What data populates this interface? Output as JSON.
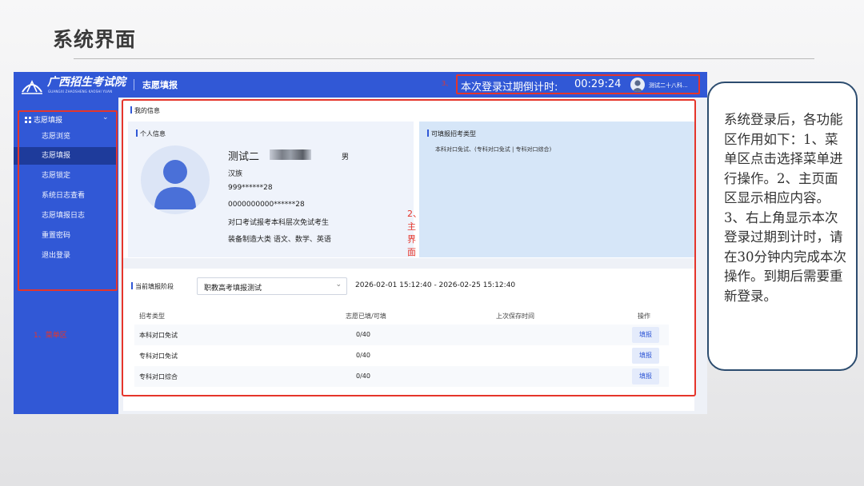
{
  "slide": {
    "title": "系统界面"
  },
  "header": {
    "logo_text": "广西招生考试院",
    "logo_subtitle": "GUANGXI ZHAOSHENG KAOSHI YUAN",
    "app_title": "志愿填报",
    "marker_3": "3、",
    "countdown_label": "本次登录过期倒计时:",
    "countdown_time": "00:29:24",
    "user_name": "测试二十八科..."
  },
  "sidebar": {
    "group_label": "志愿填报",
    "items": [
      {
        "label": "志愿浏览",
        "active": false
      },
      {
        "label": "志愿填报",
        "active": true
      },
      {
        "label": "志愿锁定",
        "active": false
      },
      {
        "label": "系统日志查看",
        "active": false
      },
      {
        "label": "志愿填报日志",
        "active": false
      },
      {
        "label": "重置密码",
        "active": false
      },
      {
        "label": "退出登录",
        "active": false
      }
    ],
    "area_label": "1、菜单区"
  },
  "main": {
    "marker_2": "2、主界面",
    "my_info_title": "我的信息",
    "personal": {
      "title": "个人信息",
      "name": "测试二",
      "gender": "男",
      "ethnicity": "汉族",
      "id_number": "999******28",
      "exam_number": "0000000000******28",
      "exam_type": "对口考试报考本科层次免试考生",
      "major_subjects": "装备制造大类    语文、数学、英语"
    },
    "types": {
      "title": "可填报招考类型",
      "text": "本科对口免试、(专科对口免试 | 专科对口综合)"
    },
    "stage": {
      "label": "当前填报阶段",
      "selected": "职教高考填报测试",
      "period": "2026-02-01 15:12:40 - 2026-02-25 15:12:40"
    },
    "table": {
      "headers": [
        "招考类型",
        "志愿已填/可填",
        "上次保存时间",
        "操作"
      ],
      "rows": [
        {
          "type": "本科对口免试",
          "count": "0/40",
          "saved": "",
          "action": "填报"
        },
        {
          "type": "专科对口免试",
          "count": "0/40",
          "saved": "",
          "action": "填报"
        },
        {
          "type": "专科对口综合",
          "count": "0/40",
          "saved": "",
          "action": "填报"
        }
      ]
    }
  },
  "note": {
    "text": "系统登录后，各功能区作用如下：1、菜单区点击选择菜单进行操作。2、主页面区显示相应内容。3、右上角显示本次登录过期到计时，请在30分钟内完成本次操作。到期后需要重新登录。"
  },
  "colors": {
    "brand_blue": "#3158d6",
    "annotation_red": "#e5352b",
    "note_border": "#2c4c6f"
  }
}
